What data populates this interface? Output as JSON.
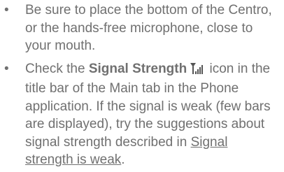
{
  "bullets": [
    {
      "symbol": "•",
      "text": "Be sure to place the bottom of the Centro, or the hands-free microphone, close to your mouth."
    },
    {
      "symbol": "•",
      "text_before": "Check the ",
      "bold_label": "Signal Strength",
      "icon": "signal-strength-icon",
      "text_middle": " icon in the title bar of the Main tab in the Phone application. If the signal is weak (few bars are displayed), try the suggestions about signal strength described in ",
      "link_text": "Signal strength is weak",
      "text_after": "."
    }
  ],
  "colors": {
    "text": "#707070",
    "icon": "#555555"
  }
}
